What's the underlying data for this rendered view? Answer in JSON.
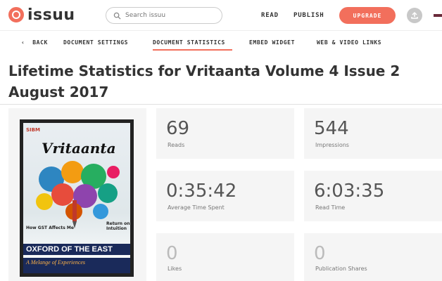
{
  "header": {
    "logo_text": "issuu",
    "search_placeholder": "Search issuu",
    "nav": {
      "read": "READ",
      "publish": "PUBLISH"
    },
    "upgrade_label": "UPGRADE",
    "accent_color": "#f26f5c"
  },
  "subnav": {
    "back": "BACK",
    "items": [
      "DOCUMENT SETTINGS",
      "DOCUMENT STATISTICS",
      "EMBED WIDGET",
      "WEB & VIDEO LINKS"
    ],
    "active": "DOCUMENT STATISTICS"
  },
  "page": {
    "title_prefix": "Lifetime Statistics for ",
    "title_doc": "Vritaanta Volume 4 Issue 2 August 2017"
  },
  "cover": {
    "masthead": "Vritaanta",
    "headline_left": "How GST Affects Me",
    "headline_right": "Return on Intuition",
    "banner": "OXFORD OF THE EAST",
    "tagline": "A Melange of Experiences"
  },
  "stats": {
    "reads": {
      "value": "69",
      "label": "Reads"
    },
    "impressions": {
      "value": "544",
      "label": "Impressions"
    },
    "avg_time": {
      "value": "0:35:42",
      "label": "Average Time Spent"
    },
    "read_time": {
      "value": "6:03:35",
      "label": "Read Time"
    },
    "likes": {
      "value": "0",
      "label": "Likes"
    },
    "shares": {
      "value": "0",
      "label": "Publication Shares"
    }
  }
}
